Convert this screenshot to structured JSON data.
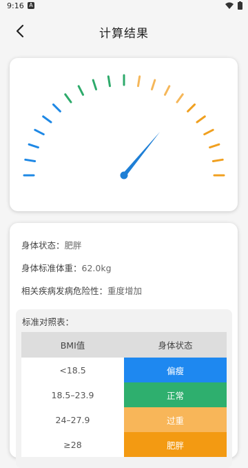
{
  "status_bar": {
    "time": "9:16",
    "notif_icon": "A"
  },
  "app_bar": {
    "title": "计算结果"
  },
  "gauge": {
    "value_fraction": 0.72,
    "colors": {
      "blue": "#1e88e5",
      "green": "#2eaa6b",
      "orange_light": "#f5b75a",
      "orange": "#f0a020",
      "needle": "#1e7fd6"
    }
  },
  "result": {
    "status_label": "身体状态：",
    "status_value": "肥胖",
    "std_weight_label": "身体标准体重：",
    "std_weight_value": "62.0kg",
    "risk_label": "相关疾病发病危险性：",
    "risk_value": "重度增加"
  },
  "table": {
    "title": "标准对照表：",
    "headers": [
      "BMI值",
      "身体状态"
    ],
    "rows": [
      {
        "range": "<18.5",
        "status": "偏瘦",
        "color": "#1e88f0"
      },
      {
        "range": "18.5–23.9",
        "status": "正常",
        "color": "#2eaf6e"
      },
      {
        "range": "24–27.9",
        "status": "过重",
        "color": "#f8b659"
      },
      {
        "range": "≥28",
        "status": "肥胖",
        "color": "#f39a12"
      }
    ]
  }
}
